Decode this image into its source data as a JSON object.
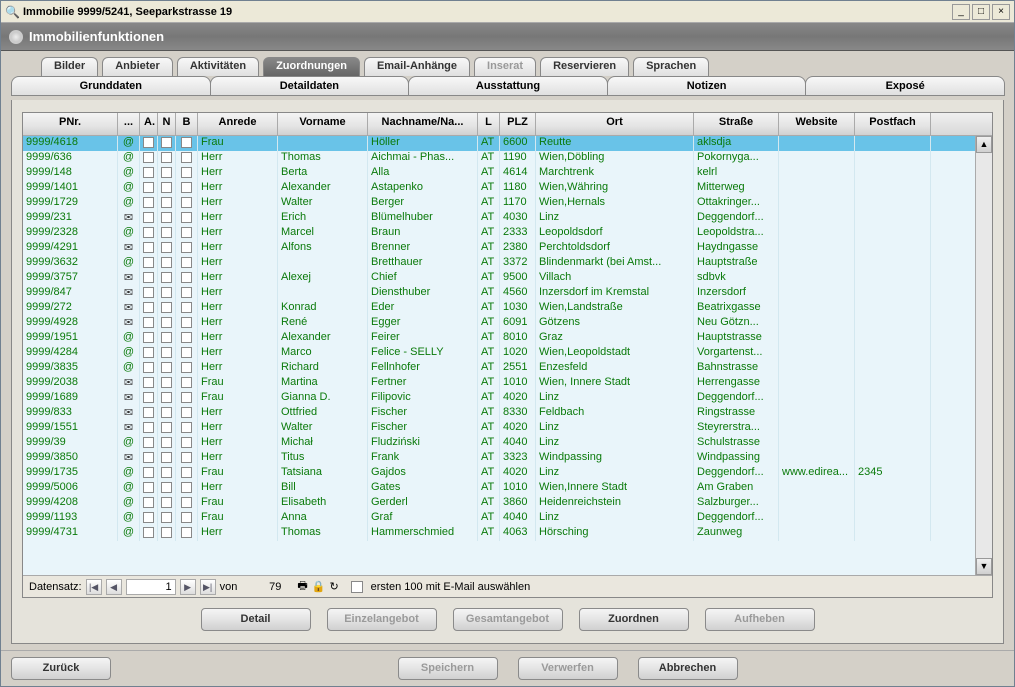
{
  "window": {
    "title": "Immobilie 9999/5241, Seeparkstrasse 19"
  },
  "funcbar": {
    "label": "Immobilienfunktionen"
  },
  "tabs_top": [
    {
      "label": "Bilder",
      "name": "tab-bilder"
    },
    {
      "label": "Anbieter",
      "name": "tab-anbieter"
    },
    {
      "label": "Aktivitäten",
      "name": "tab-aktivitaeten"
    },
    {
      "label": "Zuordnungen",
      "name": "tab-zuordnungen",
      "active": true
    },
    {
      "label": "Email-Anhänge",
      "name": "tab-emailanhaenge"
    },
    {
      "label": "Inserat",
      "name": "tab-inserat",
      "disabled": true
    },
    {
      "label": "Reservieren",
      "name": "tab-reservieren"
    },
    {
      "label": "Sprachen",
      "name": "tab-sprachen"
    }
  ],
  "tabs_bottom": [
    {
      "label": "Grunddaten",
      "name": "tab-grunddaten"
    },
    {
      "label": "Detaildaten",
      "name": "tab-detaildaten"
    },
    {
      "label": "Ausstattung",
      "name": "tab-ausstattung"
    },
    {
      "label": "Notizen",
      "name": "tab-notizen"
    },
    {
      "label": "Exposé",
      "name": "tab-expose"
    }
  ],
  "columns": {
    "pnr": "PNr.",
    "dots": "...",
    "a": "A.",
    "n": "N",
    "b": "B",
    "anrede": "Anrede",
    "vorname": "Vorname",
    "nachname": "Nachname/Na...",
    "l": "L",
    "plz": "PLZ",
    "ort": "Ort",
    "strasse": "Straße",
    "website": "Website",
    "postfach": "Postfach"
  },
  "rows": [
    {
      "pnr": "9999/4618",
      "ic": "@",
      "anrede": "Frau",
      "vorname": "",
      "nachname": "Höller",
      "l": "AT",
      "plz": "6600",
      "ort": "Reutte",
      "strasse": "aklsdja",
      "website": "",
      "postfach": "",
      "sel": true
    },
    {
      "pnr": "9999/636",
      "ic": "@",
      "anrede": "Herr",
      "vorname": "Thomas",
      "nachname": "Aichmai - Phas...",
      "l": "AT",
      "plz": "1190",
      "ort": "Wien,Döbling",
      "strasse": "Pokornyga...",
      "website": "",
      "postfach": ""
    },
    {
      "pnr": "9999/148",
      "ic": "@",
      "anrede": "Herr",
      "vorname": "Berta",
      "nachname": "Alla",
      "l": "AT",
      "plz": "4614",
      "ort": "Marchtrenk",
      "strasse": "kelrl",
      "website": "",
      "postfach": ""
    },
    {
      "pnr": "9999/1401",
      "ic": "@",
      "anrede": "Herr",
      "vorname": "Alexander",
      "nachname": "Astapenko",
      "l": "AT",
      "plz": "1180",
      "ort": "Wien,Währing",
      "strasse": "Mitterweg",
      "website": "",
      "postfach": ""
    },
    {
      "pnr": "9999/1729",
      "ic": "@",
      "anrede": "Herr",
      "vorname": "Walter",
      "nachname": "Berger",
      "l": "AT",
      "plz": "1170",
      "ort": "Wien,Hernals",
      "strasse": "Ottakringer...",
      "website": "",
      "postfach": ""
    },
    {
      "pnr": "9999/231",
      "ic": "✉",
      "anrede": "Herr",
      "vorname": "Erich",
      "nachname": "Blümelhuber",
      "l": "AT",
      "plz": "4030",
      "ort": "Linz",
      "strasse": "Deggendorf...",
      "website": "",
      "postfach": ""
    },
    {
      "pnr": "9999/2328",
      "ic": "@",
      "anrede": "Herr",
      "vorname": "Marcel",
      "nachname": "Braun",
      "l": "AT",
      "plz": "2333",
      "ort": "Leopoldsdorf",
      "strasse": "Leopoldstra...",
      "website": "",
      "postfach": ""
    },
    {
      "pnr": "9999/4291",
      "ic": "✉",
      "anrede": "Herr",
      "vorname": "Alfons",
      "nachname": "Brenner",
      "l": "AT",
      "plz": "2380",
      "ort": "Perchtoldsdorf",
      "strasse": "Haydngasse",
      "website": "",
      "postfach": ""
    },
    {
      "pnr": "9999/3632",
      "ic": "@",
      "anrede": "Herr",
      "vorname": "",
      "nachname": "Bretthauer",
      "l": "AT",
      "plz": "3372",
      "ort": "Blindenmarkt (bei Amst...",
      "strasse": "Hauptstraße",
      "website": "",
      "postfach": ""
    },
    {
      "pnr": "9999/3757",
      "ic": "✉",
      "anrede": "Herr",
      "vorname": "Alexej",
      "nachname": "Chief",
      "l": "AT",
      "plz": "9500",
      "ort": "Villach",
      "strasse": "sdbvk",
      "website": "",
      "postfach": ""
    },
    {
      "pnr": "9999/847",
      "ic": "✉",
      "anrede": "Herr",
      "vorname": "",
      "nachname": "Diensthuber",
      "l": "AT",
      "plz": "4560",
      "ort": "Inzersdorf im Kremstal",
      "strasse": "Inzersdorf",
      "website": "",
      "postfach": ""
    },
    {
      "pnr": "9999/272",
      "ic": "✉",
      "anrede": "Herr",
      "vorname": "Konrad",
      "nachname": "Eder",
      "l": "AT",
      "plz": "1030",
      "ort": "Wien,Landstraße",
      "strasse": "Beatrixgasse",
      "website": "",
      "postfach": ""
    },
    {
      "pnr": "9999/4928",
      "ic": "✉",
      "anrede": "Herr",
      "vorname": "René",
      "nachname": "Egger",
      "l": "AT",
      "plz": "6091",
      "ort": "Götzens",
      "strasse": "Neu Götzn...",
      "website": "",
      "postfach": ""
    },
    {
      "pnr": "9999/1951",
      "ic": "@",
      "anrede": "Herr",
      "vorname": "Alexander",
      "nachname": "Feirer",
      "l": "AT",
      "plz": "8010",
      "ort": "Graz",
      "strasse": "Hauptstrasse",
      "website": "",
      "postfach": ""
    },
    {
      "pnr": "9999/4284",
      "ic": "@",
      "anrede": "Herr",
      "vorname": "Marco",
      "nachname": "Felice - SELLY",
      "l": "AT",
      "plz": "1020",
      "ort": "Wien,Leopoldstadt",
      "strasse": "Vorgartenst...",
      "website": "",
      "postfach": ""
    },
    {
      "pnr": "9999/3835",
      "ic": "@",
      "anrede": "Herr",
      "vorname": "Richard",
      "nachname": "Fellnhofer",
      "l": "AT",
      "plz": "2551",
      "ort": "Enzesfeld",
      "strasse": "Bahnstrasse",
      "website": "",
      "postfach": ""
    },
    {
      "pnr": "9999/2038",
      "ic": "✉",
      "anrede": "Frau",
      "vorname": "Martina",
      "nachname": "Fertner",
      "l": "AT",
      "plz": "1010",
      "ort": "Wien, Innere Stadt",
      "strasse": "Herrengasse",
      "website": "",
      "postfach": ""
    },
    {
      "pnr": "9999/1689",
      "ic": "✉",
      "anrede": "Frau",
      "vorname": "Gianna D.",
      "nachname": "Filipovic",
      "l": "AT",
      "plz": "4020",
      "ort": "Linz",
      "strasse": "Deggendorf...",
      "website": "",
      "postfach": ""
    },
    {
      "pnr": "9999/833",
      "ic": "✉",
      "anrede": "Herr",
      "vorname": "Ottfried",
      "nachname": "Fischer",
      "l": "AT",
      "plz": "8330",
      "ort": "Feldbach",
      "strasse": "Ringstrasse",
      "website": "",
      "postfach": ""
    },
    {
      "pnr": "9999/1551",
      "ic": "✉",
      "anrede": "Herr",
      "vorname": "Walter",
      "nachname": "Fischer",
      "l": "AT",
      "plz": "4020",
      "ort": "Linz",
      "strasse": "Steyrerstra...",
      "website": "",
      "postfach": ""
    },
    {
      "pnr": "9999/39",
      "ic": "@",
      "anrede": "Herr",
      "vorname": "Michał",
      "nachname": "Fludziński",
      "l": "AT",
      "plz": "4040",
      "ort": "Linz",
      "strasse": "Schulstrasse",
      "website": "",
      "postfach": ""
    },
    {
      "pnr": "9999/3850",
      "ic": "✉",
      "anrede": "Herr",
      "vorname": "Titus",
      "nachname": "Frank",
      "l": "AT",
      "plz": "3323",
      "ort": "Windpassing",
      "strasse": "Windpassing",
      "website": "",
      "postfach": ""
    },
    {
      "pnr": "9999/1735",
      "ic": "@",
      "anrede": "Frau",
      "vorname": "Tatsiana",
      "nachname": "Gajdos",
      "l": "AT",
      "plz": "4020",
      "ort": "Linz",
      "strasse": "Deggendorf...",
      "website": "www.edirea...",
      "postfach": "2345"
    },
    {
      "pnr": "9999/5006",
      "ic": "@",
      "anrede": "Herr",
      "vorname": "Bill",
      "nachname": "Gates",
      "l": "AT",
      "plz": "1010",
      "ort": "Wien,Innere Stadt",
      "strasse": "Am Graben",
      "website": "",
      "postfach": ""
    },
    {
      "pnr": "9999/4208",
      "ic": "@",
      "anrede": "Frau",
      "vorname": "Elisabeth",
      "nachname": "Gerderl",
      "l": "AT",
      "plz": "3860",
      "ort": "Heidenreichstein",
      "strasse": "Salzburger...",
      "website": "",
      "postfach": ""
    },
    {
      "pnr": "9999/1193",
      "ic": "@",
      "anrede": "Frau",
      "vorname": "Anna",
      "nachname": "Graf",
      "l": "AT",
      "plz": "4040",
      "ort": "Linz",
      "strasse": "Deggendorf...",
      "website": "",
      "postfach": ""
    },
    {
      "pnr": "9999/4731",
      "ic": "@",
      "anrede": "Herr",
      "vorname": "Thomas",
      "nachname": "Hammerschmied",
      "l": "AT",
      "plz": "4063",
      "ort": "Hörsching",
      "strasse": "Zaunweg",
      "website": "",
      "postfach": ""
    }
  ],
  "recordbar": {
    "label": "Datensatz:",
    "current": "1",
    "von": "von",
    "total": "79",
    "check_label": "ersten 100 mit E-Mail auswählen"
  },
  "buttons": {
    "detail": "Detail",
    "einzel": "Einzelangebot",
    "gesamt": "Gesamtangebot",
    "zuordnen": "Zuordnen",
    "aufheben": "Aufheben",
    "zurueck": "Zurück",
    "speichern": "Speichern",
    "verwerfen": "Verwerfen",
    "abbrechen": "Abbrechen"
  }
}
